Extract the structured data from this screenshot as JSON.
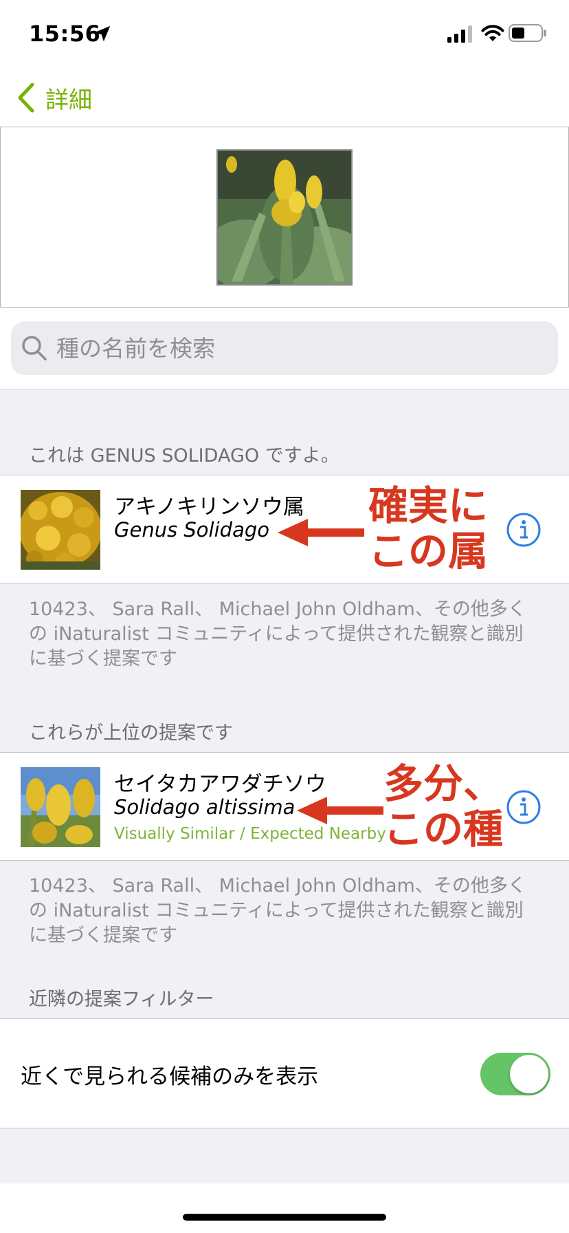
{
  "status": {
    "time": "15:56"
  },
  "nav": {
    "back_label": "詳細"
  },
  "search": {
    "placeholder": "種の名前を検索"
  },
  "sections": {
    "genus_header": "これは GENUS SOLIDAGO ですよ。",
    "top_header": "これらが上位の提案です",
    "filter_header": "近隣の提案フィルター"
  },
  "genus_row": {
    "common_name": "アキノキリンソウ属",
    "scientific_name": "Genus Solidago",
    "annotation_line1": "確実に",
    "annotation_line2": "この属"
  },
  "species_row": {
    "common_name": "セイタカアワダチソウ",
    "scientific_name": "Solidago altissima",
    "tag": "Visually Similar / Expected Nearby",
    "annotation_line1": "多分、",
    "annotation_line2": "この種"
  },
  "footnotes": {
    "genus_line1": "10423、 Sara Rall、 Michael John Oldham、その他多く",
    "genus_line2": "の iNaturalist コミュニティによって提供された観察と識別",
    "genus_line3": "に基づく提案です",
    "species_line1": "10423、 Sara Rall、 Michael John Oldham、その他多く",
    "species_line2": "の iNaturalist コミュニティによって提供された観察と識別",
    "species_line3": "に基づく提案です"
  },
  "filter": {
    "toggle_label": "近くで見られる候補のみを表示",
    "toggle_on": true
  },
  "colors": {
    "accent_green": "#77b300",
    "tag_green": "#7fb43a",
    "annotation_red": "#d8371f",
    "info_blue": "#2f7ee0",
    "toggle_green": "#65c466"
  },
  "icons": {
    "back": "chevron-left-icon",
    "search": "magnifier-icon",
    "info": "info-circle-icon",
    "location": "location-arrow-icon"
  }
}
